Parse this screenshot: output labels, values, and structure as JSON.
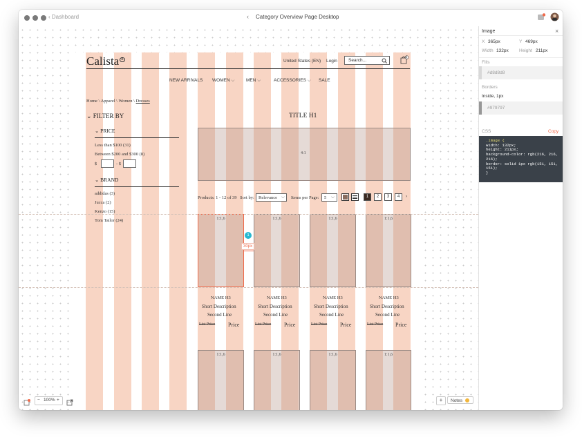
{
  "titlebar": {
    "back_label": "Dashboard",
    "title": "Category Overview Page Desktop"
  },
  "site": {
    "logo": "Calista",
    "region": "United States (EN)",
    "login": "Login",
    "search_placeholder": "Search...",
    "cart_count": "0",
    "nav": [
      "NEW ARRIVALS",
      "WOMEN",
      "MEN",
      "ACCESSORIES",
      "SALE"
    ],
    "breadcrumb": {
      "path": "Home \\ Apparel \\ Women \\ ",
      "current": "Dresses"
    },
    "filter_title": "FILTER BY",
    "price_title": "PRICE",
    "price_options": [
      "Less than $100 (31)",
      "Between $200 and $300 (8)"
    ],
    "price_from_symbol": "$",
    "price_sep": "- $",
    "brand_title": "BRAND",
    "brands": [
      "addidas (3)",
      "Jucca (2)",
      "Kenzo (15)",
      "Tom Tailor (24)"
    ],
    "page_title": "TITLE H1",
    "banner_ratio": "4:1",
    "products_count": "Products: 1 - 12 of 39",
    "sort_label": "Sort by:",
    "sort_value": "Relevance",
    "per_page_label": "Items per Page:",
    "per_page_value": "5",
    "pages": [
      "1",
      "2",
      "3",
      "4"
    ],
    "next": "›",
    "tile_ratio": "1:1,6",
    "product": {
      "name": "NAME H3",
      "desc1": "Short Description",
      "desc2": "Second Line",
      "list_price": "List Price",
      "price": "Price"
    }
  },
  "measure": {
    "marker": "1",
    "distance": "30px"
  },
  "inspector": {
    "title": "Image",
    "x_label": "X",
    "x_value": "365px",
    "y_label": "Y",
    "y_value": "469px",
    "w_label": "Width",
    "w_value": "132px",
    "h_label": "Height",
    "h_value": "211px",
    "fills_label": "Fills",
    "fill_hex": "#d8d8d8",
    "borders_label": "Borders",
    "border_desc": "Inside, 1px",
    "border_hex": "#979797",
    "css_label": "CSS",
    "copy_label": "Copy",
    "css_lines": [
      ".image {",
      "  width: 132px;",
      "  height: 211px;",
      "  background-color: rgb(216, 216,",
      "    216);",
      "  border: solid 1px rgb(151, 151,",
      "    151);",
      "}"
    ]
  },
  "footer": {
    "zoom_minus": "−",
    "zoom_value": "100%",
    "zoom_plus": "+",
    "add": "+",
    "notes": "Notes"
  },
  "colors": {
    "stripe": "#f8d5c4",
    "accent": "#f06a4a",
    "marker": "#28b8d0",
    "code_bg": "#3a4149",
    "fill": "#d8d8d8",
    "border": "#979797"
  }
}
